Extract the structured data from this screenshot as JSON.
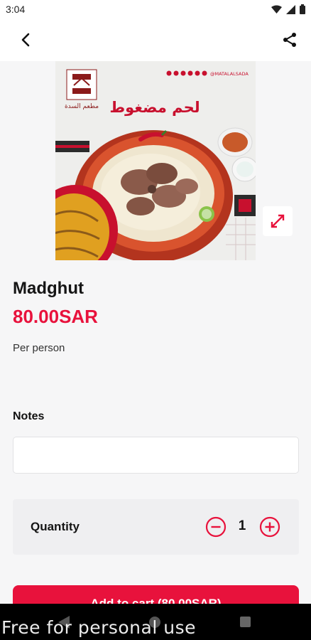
{
  "status_bar": {
    "time": "3:04"
  },
  "product": {
    "image_text": "لحم مضغوط",
    "image_handle": "@MATALALSADA",
    "image_logo_text": "مطعم السدة",
    "name": "Madghut",
    "price": "80.00SAR",
    "unit": "Per person"
  },
  "notes": {
    "label": "Notes",
    "value": "",
    "placeholder": ""
  },
  "quantity": {
    "label": "Quantity",
    "value": "1"
  },
  "cart": {
    "label": "Add to cart (80.00SAR)"
  },
  "watermark": "Free for personal use",
  "colors": {
    "accent": "#e8123c",
    "background": "#f6f6f7"
  },
  "icons": [
    "back-arrow-icon",
    "share-icon",
    "expand-icon",
    "minus-circle-icon",
    "plus-circle-icon",
    "wifi-icon",
    "signal-icon",
    "battery-icon"
  ]
}
